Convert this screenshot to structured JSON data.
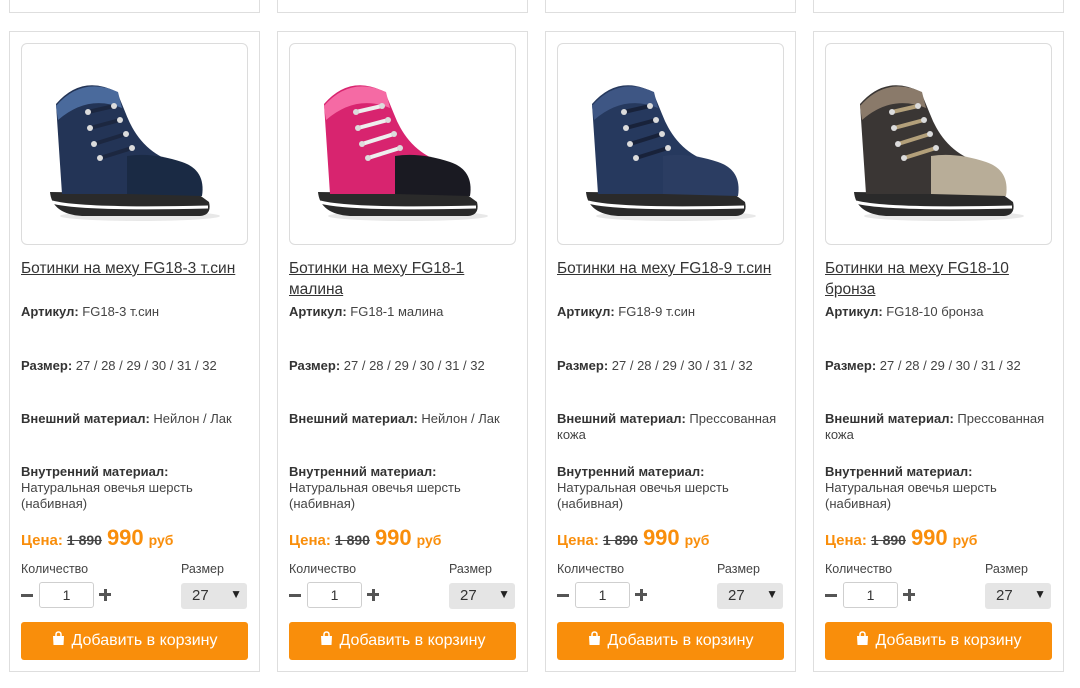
{
  "labels": {
    "article": "Артикул:",
    "size": "Размер:",
    "outer": "Внешний материал:",
    "inner": "Внутренний материал:",
    "price": "Цена:",
    "currency": "руб",
    "quantity": "Количество",
    "size_select": "Размер",
    "add_to_cart": "Добавить в корзину"
  },
  "colors": {
    "accent": "#f98e0b"
  },
  "products": [
    {
      "title": "Ботинки на меху FG18-3 т.син",
      "article": "FG18-3 т.син",
      "sizes": "27 / 28 / 29 / 30 / 31 / 32",
      "outer": "Нейлон / Лак",
      "inner": "Натуральная овечья шерсть (набивная)",
      "old_price": "1 890",
      "new_price": "990",
      "quantity": "1",
      "selected_size": "27",
      "image": "navy-boot-image",
      "boot_color": "#233456",
      "boot_highlight": "#4a6a9c",
      "lace_color": "#1c2740",
      "toe_color": "#1a2a44"
    },
    {
      "title": "Ботинки на меху FG18-1 малина",
      "article": "FG18-1 малина",
      "sizes": "27 / 28 / 29 / 30 / 31 / 32",
      "outer": "Нейлон / Лак",
      "inner": "Натуральная овечья шерсть (набивная)",
      "old_price": "1 890",
      "new_price": "990",
      "quantity": "1",
      "selected_size": "27",
      "image": "raspberry-boot-image",
      "boot_color": "#d8246f",
      "boot_highlight": "#f56aa4",
      "lace_color": "#eeeeee",
      "toe_color": "#1a1a22"
    },
    {
      "title": "Ботинки на меху FG18-9 т.син",
      "article": "FG18-9 т.син",
      "sizes": "27 / 28 / 29 / 30 / 31 / 32",
      "outer": "Прессованная кожа",
      "inner": "Натуральная овечья шерсть (набивная)",
      "old_price": "1 890",
      "new_price": "990",
      "quantity": "1",
      "selected_size": "27",
      "image": "navy-leather-boot-image",
      "boot_color": "#26395e",
      "boot_highlight": "#3e5684",
      "lace_color": "#18223a",
      "toe_color": "#2b3d62"
    },
    {
      "title": "Ботинки на меху FG18-10 бронза",
      "article": "FG18-10 бронза",
      "sizes": "27 / 28 / 29 / 30 / 31 / 32",
      "outer": "Прессованная кожа",
      "inner": "Натуральная овечья шерсть (набивная)",
      "old_price": "1 890",
      "new_price": "990",
      "quantity": "1",
      "selected_size": "27",
      "image": "bronze-boot-image",
      "boot_color": "#3a3634",
      "boot_highlight": "#8a7a6a",
      "lace_color": "#b3a07a",
      "toe_color": "#b8ad98"
    }
  ]
}
